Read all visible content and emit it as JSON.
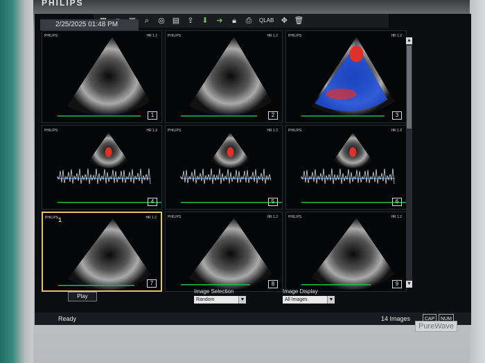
{
  "brand": "PHILIPS",
  "badge_brand": "PureWave",
  "toolbar": {
    "items": [
      {
        "icon": "grid-icon"
      },
      {
        "icon": "blue-square-icon"
      },
      {
        "icon": "image-icon"
      },
      {
        "icon": "zoom-icon"
      },
      {
        "icon": "target-icon"
      },
      {
        "icon": "report-icon"
      },
      {
        "icon": "export-icon"
      },
      {
        "icon": "save-icon"
      },
      {
        "icon": "send-icon"
      },
      {
        "icon": "lock-icon"
      },
      {
        "icon": "print-icon"
      },
      {
        "text": "QLAB"
      },
      {
        "icon": "tools-icon"
      },
      {
        "icon": "delete-icon"
      }
    ]
  },
  "header": {
    "date": "2/25/2025 01:48 PM"
  },
  "tiles": [
    {
      "number": "1",
      "type": "2d",
      "meta_left": "PHILIPS",
      "meta_right": "HR 1.2"
    },
    {
      "number": "2",
      "type": "2d",
      "meta_left": "PHILIPS",
      "meta_right": "HR 1.2"
    },
    {
      "number": "3",
      "type": "color",
      "meta_left": "PHILIPS",
      "meta_right": "HR 1.2"
    },
    {
      "number": "4",
      "type": "doppler",
      "meta_left": "PHILIPS",
      "meta_right": "HR 1.2"
    },
    {
      "number": "5",
      "type": "doppler",
      "meta_left": "PHILIPS",
      "meta_right": "HR 1.2"
    },
    {
      "number": "6",
      "type": "doppler",
      "meta_left": "PHILIPS",
      "meta_right": "HR 1.2"
    },
    {
      "number": "7",
      "type": "2d",
      "meta_left": "PHILIPS",
      "meta_right": "HR 1.2",
      "selected": true,
      "sel_index": "1"
    },
    {
      "number": "8",
      "type": "2d",
      "meta_left": "PHILIPS",
      "meta_right": "HR 1.2"
    },
    {
      "number": "9",
      "type": "2d",
      "meta_left": "PHILIPS",
      "meta_right": "HR 1.2"
    }
  ],
  "controls": {
    "play_label": "Play",
    "image_selection_label": "Image Selection",
    "image_selection_value": "Random",
    "image_display_label": "Image Display",
    "image_display_value": "All Images"
  },
  "status": {
    "ready": "Ready",
    "image_count": "14 Images",
    "cap": "CAP",
    "num": "NUM"
  },
  "colors": {
    "selected_border": "#e3c766",
    "ecg_green": "#1fbf4a",
    "doppler_red": "#e0302a",
    "doppler_blue": "#1e4fe0"
  }
}
